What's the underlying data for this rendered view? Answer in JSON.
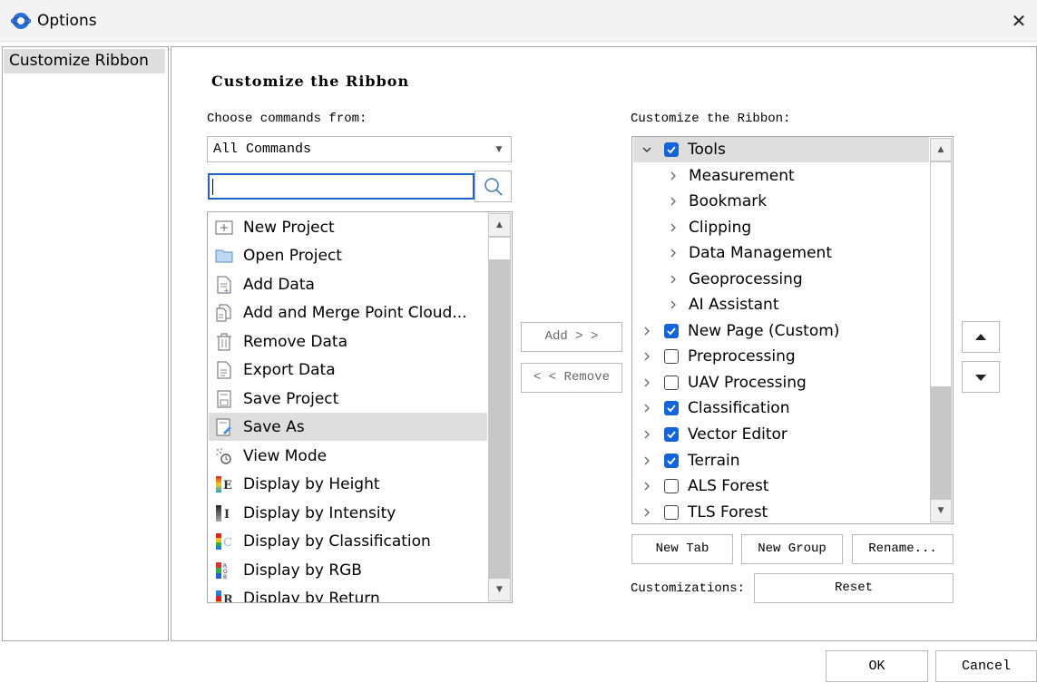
{
  "window": {
    "title": "Options"
  },
  "nav": {
    "items": [
      {
        "label": "Customize Ribbon",
        "selected": true
      }
    ]
  },
  "main": {
    "section_title": "Customize the Ribbon",
    "choose_label": "Choose commands from:",
    "customize_label": "Customize the Ribbon:",
    "commands_select": {
      "value": "All Commands"
    },
    "search": {
      "value": "",
      "placeholder": ""
    },
    "commands": [
      {
        "label": "New Project",
        "icon": "new-project-icon"
      },
      {
        "label": "Open Project",
        "icon": "folder-icon"
      },
      {
        "label": "Add Data",
        "icon": "add-data-icon"
      },
      {
        "label": "Add and Merge Point Cloud...",
        "icon": "merge-point-cloud-icon"
      },
      {
        "label": "Remove Data",
        "icon": "trash-icon"
      },
      {
        "label": "Export Data",
        "icon": "export-data-icon"
      },
      {
        "label": "Save Project",
        "icon": "save-project-icon"
      },
      {
        "label": "Save As",
        "icon": "save-as-icon",
        "selected": true
      },
      {
        "label": "View Mode",
        "icon": "view-mode-icon"
      },
      {
        "label": "Display by Height",
        "icon": "display-height-icon"
      },
      {
        "label": "Display by Intensity",
        "icon": "display-intensity-icon"
      },
      {
        "label": "Display by Classification",
        "icon": "display-classification-icon"
      },
      {
        "label": "Display by RGB",
        "icon": "display-rgb-icon"
      },
      {
        "label": "Display by Return",
        "icon": "display-return-icon"
      }
    ],
    "add_button": "Add > >",
    "remove_button": "< < Remove",
    "ribbon_tree": [
      {
        "label": "Tools",
        "level": 0,
        "expanded": true,
        "checkbox": true,
        "checked": true,
        "selected": true
      },
      {
        "label": "Measurement",
        "level": 1
      },
      {
        "label": "Bookmark",
        "level": 1
      },
      {
        "label": "Clipping",
        "level": 1
      },
      {
        "label": "Data Management",
        "level": 1
      },
      {
        "label": "Geoprocessing",
        "level": 1
      },
      {
        "label": "AI Assistant",
        "level": 1
      },
      {
        "label": "New Page (Custom)",
        "level": 0,
        "checkbox": true,
        "checked": true
      },
      {
        "label": "Preprocessing",
        "level": 0,
        "checkbox": true,
        "checked": false
      },
      {
        "label": "UAV Processing",
        "level": 0,
        "checkbox": true,
        "checked": false
      },
      {
        "label": "Classification",
        "level": 0,
        "checkbox": true,
        "checked": true
      },
      {
        "label": "Vector Editor",
        "level": 0,
        "checkbox": true,
        "checked": true
      },
      {
        "label": "Terrain",
        "level": 0,
        "checkbox": true,
        "checked": true
      },
      {
        "label": "ALS Forest",
        "level": 0,
        "checkbox": true,
        "checked": false
      },
      {
        "label": "TLS Forest",
        "level": 0,
        "checkbox": true,
        "checked": false
      }
    ],
    "new_tab_button": "New Tab",
    "new_group_button": "New Group",
    "rename_button": "Rename...",
    "customizations_label": "Customizations:",
    "reset_button": "Reset"
  },
  "footer": {
    "ok": "OK",
    "cancel": "Cancel"
  },
  "colors": {
    "accent": "#1565d8",
    "selection": "#dedede",
    "border": "#a8a8a8",
    "scrollbar": "#c7c7c7"
  }
}
